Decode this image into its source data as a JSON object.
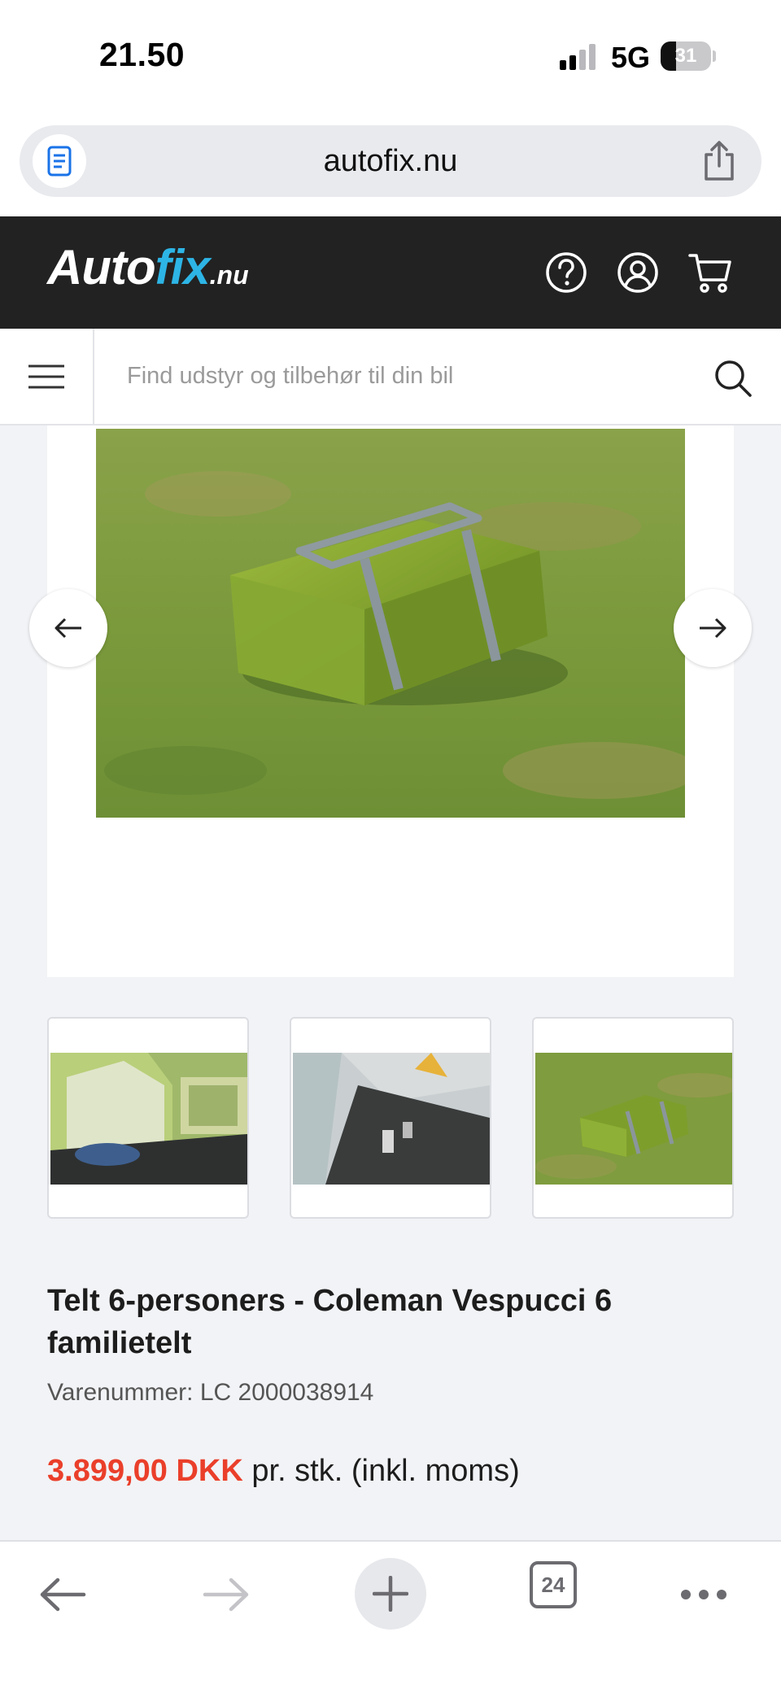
{
  "status_bar": {
    "time": "21.50",
    "network": "5G",
    "battery": "31",
    "battery_percent": 31
  },
  "browser": {
    "url": "autofix.nu",
    "open_tabs": "24"
  },
  "header": {
    "logo_main": "Auto",
    "logo_accent": "fix",
    "logo_suffix": ".nu",
    "icons": [
      "help-icon",
      "account-icon",
      "cart-icon"
    ]
  },
  "search": {
    "placeholder": "Find udstyr og tilbehør til din bil",
    "value": ""
  },
  "product": {
    "title": "Telt 6-personers - Coleman Vespucci 6 familietelt",
    "sku": "Varenummer: LC 2000038914",
    "price": "3.899,00 DKK",
    "price_suffix": "pr. stk. (inkl. moms)"
  },
  "gallery": {
    "thumbnails": [
      "tent-interior",
      "tent-floor-detail",
      "tent-carry-bag"
    ]
  },
  "colors": {
    "header_bg": "#222222",
    "brand_blue": "#2db5e6",
    "price_red": "#ea3f2a",
    "page_bg": "#f2f3f6"
  }
}
